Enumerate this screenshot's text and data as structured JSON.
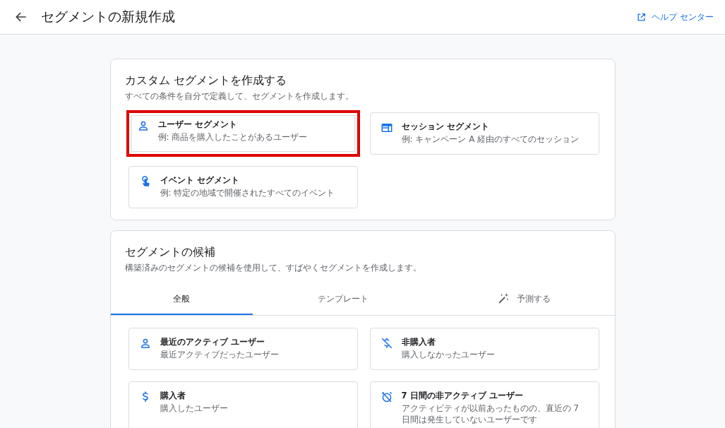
{
  "header": {
    "title": "セグメントの新規作成",
    "help_link": "ヘルプ センター"
  },
  "custom": {
    "title": "カスタム セグメントを作成する",
    "description": "すべての条件を自分で定義して、セグメントを作成します。",
    "options": [
      {
        "kind": "user",
        "title": "ユーザー セグメント",
        "example": "例: 商品を購入したことがあるユーザー",
        "highlighted": true
      },
      {
        "kind": "session",
        "title": "セッション セグメント",
        "example": "例: キャンペーン A 経由のすべてのセッション",
        "highlighted": false
      },
      {
        "kind": "event",
        "title": "イベント セグメント",
        "example": "例: 特定の地域で開催されたすべてのイベント",
        "highlighted": false
      }
    ]
  },
  "suggestions": {
    "title": "セグメントの候補",
    "description": "構築済みのセグメントの候補を使用して、すばやくセグメントを作成します。",
    "tabs": [
      {
        "label": "全般",
        "selected": true,
        "kind": "plain"
      },
      {
        "label": "テンプレート",
        "selected": false,
        "kind": "plain"
      },
      {
        "label": "予測する",
        "selected": false,
        "kind": "predictive"
      }
    ],
    "items": [
      {
        "kind": "user",
        "title": "最近のアクティブ ユーザー",
        "description": "最近アクティブだったユーザー"
      },
      {
        "kind": "nonpurchaser",
        "title": "非購入者",
        "description": "購入しなかったユーザー"
      },
      {
        "kind": "purchaser",
        "title": "購入者",
        "description": "購入したユーザー"
      },
      {
        "kind": "inactive",
        "title": "7 日間の非アクティブ ユーザー",
        "description": "アクティビティが以前あったものの、直近の 7 日間は発生していないユーザーです"
      }
    ]
  }
}
